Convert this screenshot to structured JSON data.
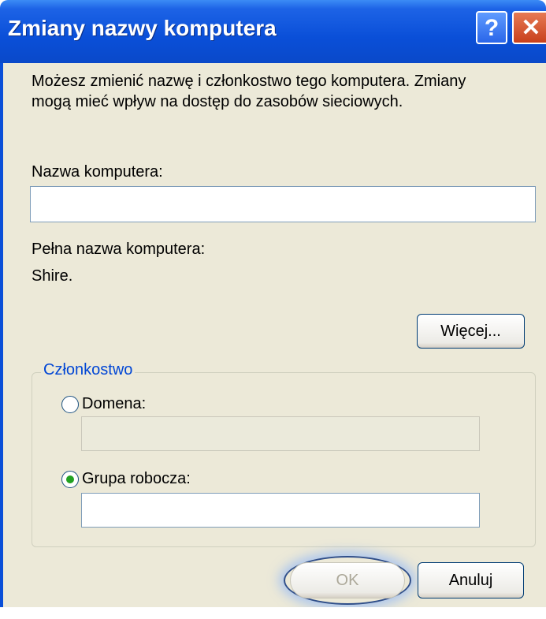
{
  "dialog": {
    "title": "Zmiany nazwy komputera",
    "help_symbol": "?",
    "close_symbol": "✕"
  },
  "description": {
    "line1": "Możesz zmienić nazwę i członkostwo tego komputera. Zmiany",
    "line2": "mogą mieć wpływ na dostęp do zasobów sieciowych."
  },
  "computer_name": {
    "label": "Nazwa komputera:",
    "value": ""
  },
  "full_name": {
    "label": "Pełna nazwa komputera:",
    "value": "Shire."
  },
  "more_button": "Więcej...",
  "membership": {
    "label": "Członkostwo",
    "domain": {
      "label": "Domena:",
      "selected": false,
      "value": "",
      "enabled": false
    },
    "workgroup": {
      "label": "Grupa robocza:",
      "selected": true,
      "value": ""
    }
  },
  "buttons": {
    "ok": "OK",
    "cancel": "Anuluj"
  },
  "colors": {
    "title_bar": "#0a4fd8",
    "dialog_bg": "#ece9d8",
    "group_label": "#0046d5",
    "radio_dot": "#21a121",
    "close_button": "#d6481f"
  },
  "icons": {
    "help": "help-icon",
    "close": "close-icon"
  }
}
